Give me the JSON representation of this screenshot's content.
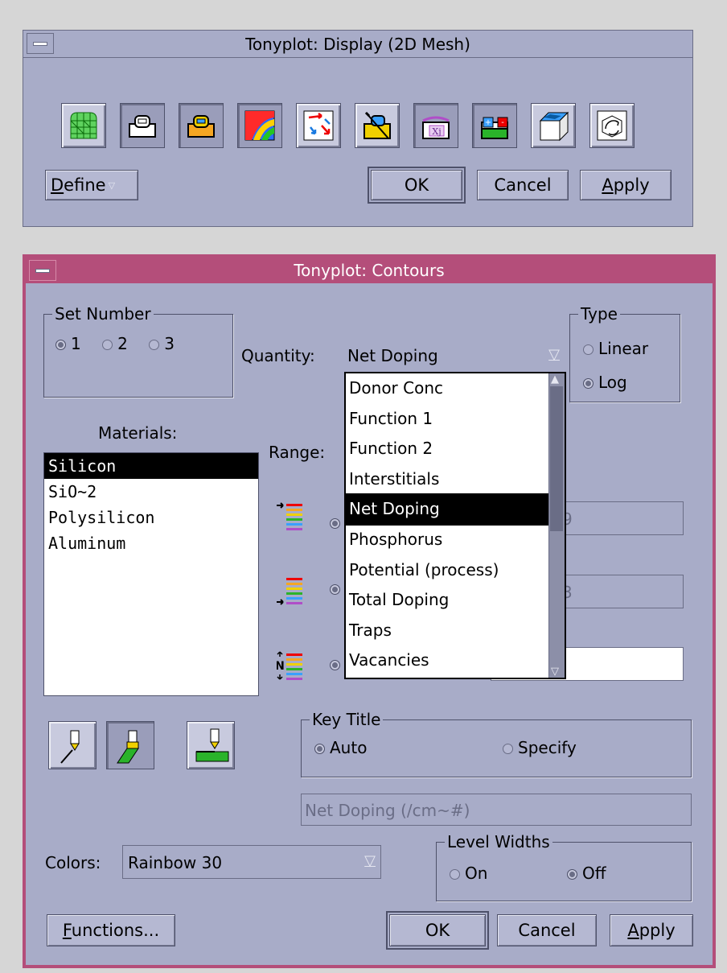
{
  "display_window": {
    "title": "Tonyplot: Display (2D Mesh)",
    "toolbar_icons": [
      "mesh-icon",
      "edges-icon",
      "regions-icon",
      "contours-icon",
      "vectors-icon",
      "lightning-icon",
      "junctions-icon",
      "electrodes-icon",
      "3d-view-icon",
      "rotate-icon"
    ],
    "define_label": "Define",
    "ok_label": "OK",
    "cancel_label": "Cancel",
    "apply_label": "Apply"
  },
  "contours_window": {
    "title": "Tonyplot: Contours",
    "set_number": {
      "title": "Set Number",
      "options": [
        "1",
        "2",
        "3"
      ],
      "selected": "1"
    },
    "type": {
      "title": "Type",
      "options": [
        "Linear",
        "Log"
      ],
      "selected": "Log"
    },
    "quantity": {
      "label": "Quantity:",
      "value": "Net Doping",
      "options": [
        "Donor Conc",
        "Function 1",
        "Function 2",
        "Interstitials",
        "Net Doping",
        "Phosphorus",
        "Potential (process)",
        "Total Doping",
        "Traps",
        "Vacancies"
      ],
      "selected": "Net Doping"
    },
    "materials": {
      "label": "Materials:",
      "items": [
        "Silicon",
        "SiO~2",
        "Polysilicon",
        "Aluminum"
      ],
      "selected": "Silicon"
    },
    "range_label": "Range:",
    "range_fields": {
      "min_partial": "9",
      "max_partial": "3"
    },
    "key_title": {
      "title": "Key Title",
      "options": [
        "Auto",
        "Specify"
      ],
      "selected": "Auto",
      "text_value": "Net Doping (/cm~#)"
    },
    "colors": {
      "label": "Colors:",
      "value": "Rainbow 30"
    },
    "level_widths": {
      "title": "Level Widths",
      "options": [
        "On",
        "Off"
      ],
      "selected": "Off"
    },
    "functions_label": "Functions...",
    "ok_label": "OK",
    "cancel_label": "Cancel",
    "apply_label": "Apply"
  },
  "colors": {
    "window_bg": "#a8acc8",
    "active_title": "#b44e7a",
    "selection": "#000000"
  }
}
